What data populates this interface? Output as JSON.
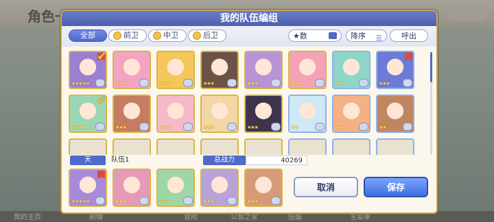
{
  "background": {
    "title": "角色一览",
    "nav_items": [
      "我的主页",
      "剧情",
      "冒险",
      "公会之家",
      "扭蛋",
      "主菜单"
    ]
  },
  "modal": {
    "title": "我的队伍编组",
    "tabs": [
      {
        "label": "全部",
        "active": true
      },
      {
        "label": "前卫",
        "active": false
      },
      {
        "label": "中卫",
        "active": false
      },
      {
        "label": "后卫",
        "active": false
      }
    ],
    "sort_label": "★数",
    "order_label": "降序",
    "call_label": "呼出"
  },
  "characters": {
    "row1": [
      {
        "stars": "★★★★★",
        "checked": true,
        "medal": true,
        "color": "#9b7fd1",
        "frame": "gold"
      },
      {
        "stars": "★★★",
        "color": "#f2a4c0",
        "frame": "gold"
      },
      {
        "stars": "★★★",
        "color": "#f6c65b",
        "frame": "gold"
      },
      {
        "stars": "★★★",
        "color": "#6d5248",
        "frame": "gold"
      },
      {
        "stars": "★★★",
        "color": "#b694d6",
        "frame": "gold"
      },
      {
        "stars": "★★★",
        "color": "#f4a3b6",
        "frame": "gold"
      },
      {
        "stars": "★★",
        "color": "#8fd6c8",
        "frame": "blue"
      },
      {
        "stars": "★★★",
        "medal": true,
        "color": "#6b7bd6",
        "frame": "blue"
      }
    ],
    "row2": [
      {
        "stars": "★★★★",
        "checked": true,
        "color": "#9dd6b4",
        "frame": "gold"
      },
      {
        "stars": "★★★",
        "color": "#c57d62",
        "frame": "gold"
      },
      {
        "stars": "★★★",
        "color": "#f5b9c8",
        "frame": "gold"
      },
      {
        "stars": "★★★",
        "color": "#f2d6a4",
        "frame": "gold"
      },
      {
        "stars": "★★★",
        "color": "#3f344d",
        "frame": "gold"
      },
      {
        "stars": "★★",
        "color": "#cfe8f6",
        "frame": "blue"
      },
      {
        "stars": "★★",
        "color": "#f3b184",
        "frame": "blue"
      },
      {
        "stars": "★★",
        "color": "#c08660",
        "frame": "blue"
      }
    ]
  },
  "team": {
    "number_label": "天",
    "name": "队伍1",
    "power_label": "总战力",
    "power_value": "40269",
    "members": [
      {
        "stars": "★★★★★",
        "medal": true,
        "color": "#a88ad9"
      },
      {
        "stars": "★★★",
        "color": "#e69ab8"
      },
      {
        "stars": "★★★",
        "color": "#9fd6a6"
      },
      {
        "stars": "★★★",
        "color": "#b7a3d8"
      },
      {
        "stars": "★★★",
        "color": "#d69a78"
      }
    ]
  },
  "buttons": {
    "cancel": "取消",
    "save": "保存"
  }
}
